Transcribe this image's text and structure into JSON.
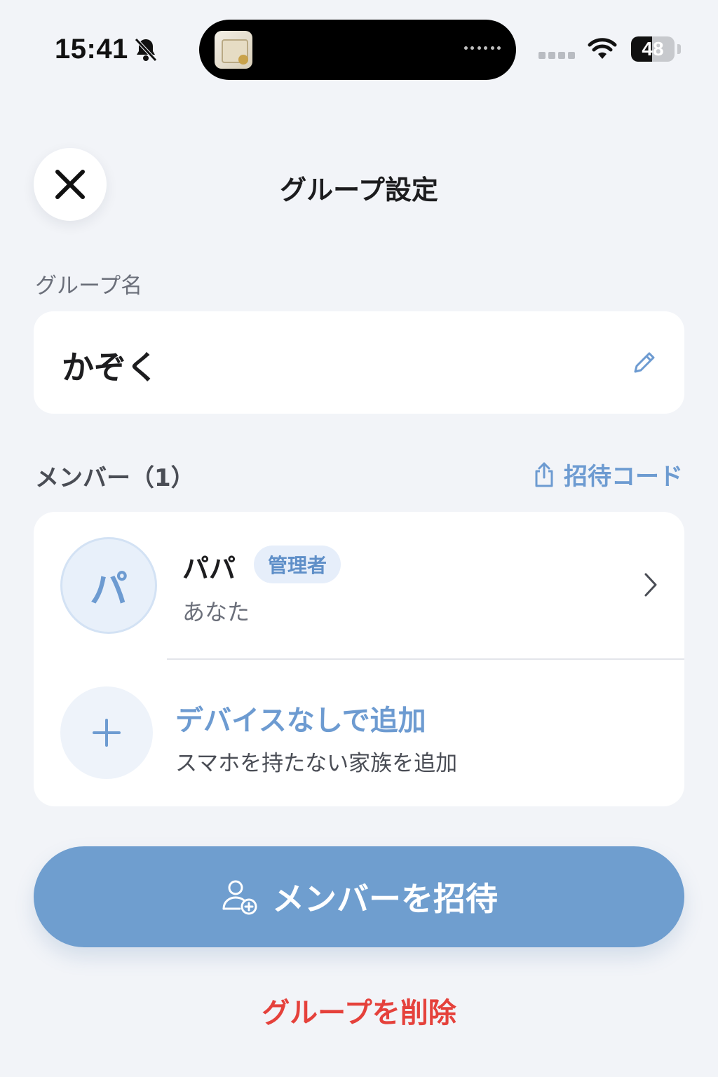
{
  "status_bar": {
    "time": "15:41",
    "battery_level": "48",
    "icons": [
      "bell-slash-icon",
      "wifi-icon",
      "battery-icon"
    ]
  },
  "header": {
    "title": "グループ設定",
    "close_icon": "close-icon"
  },
  "group_name": {
    "label": "グループ名",
    "value": "かぞく",
    "edit_icon": "pencil-icon"
  },
  "members": {
    "label": "メンバー（1）",
    "invite_code_label": "招待コード",
    "items": [
      {
        "avatar_text": "パ",
        "name": "パパ",
        "role": "管理者",
        "subtitle": "あなた"
      }
    ],
    "add_without_device": {
      "title": "デバイスなしで追加",
      "subtitle": "スマホを持たない家族を追加"
    }
  },
  "actions": {
    "invite_member": "メンバーを招待",
    "delete_group": "グループを削除"
  },
  "colors": {
    "accent": "#6f9ecf",
    "accent_text": "#6d9bd1",
    "danger": "#e5413b",
    "background": "#f2f4f8"
  }
}
